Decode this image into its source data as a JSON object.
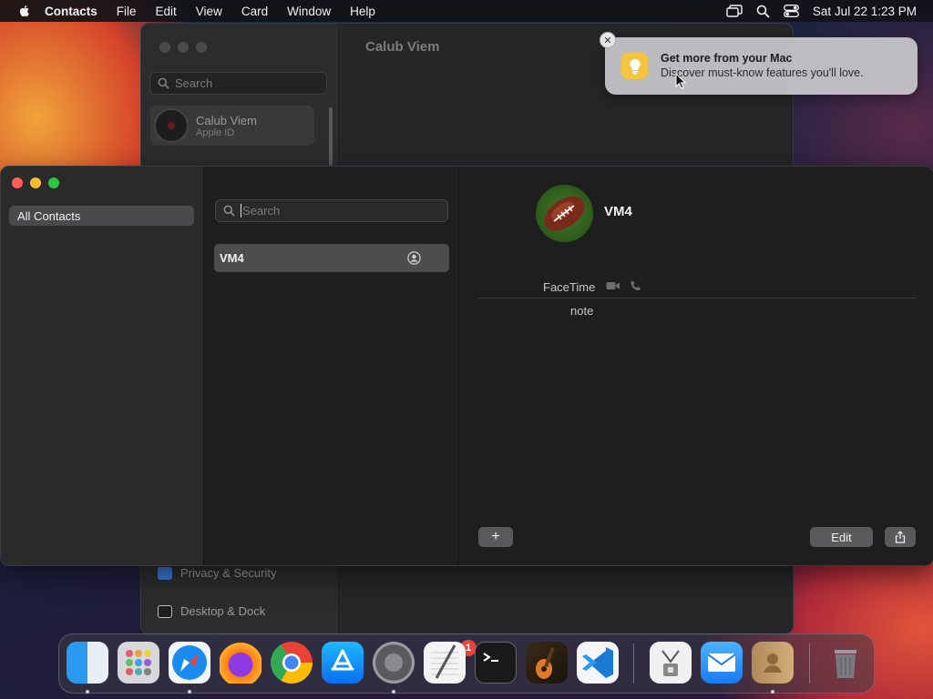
{
  "menubar": {
    "app_name": "Contacts",
    "items": [
      "File",
      "Edit",
      "View",
      "Card",
      "Window",
      "Help"
    ],
    "datetime": "Sat Jul 22  1:23 PM"
  },
  "background_window": {
    "title": "Calub Viem",
    "search_placeholder": "Search",
    "account_name": "Calub Viem",
    "account_subtitle": "Apple ID",
    "sidebar_items": [
      "Privacy & Security",
      "Desktop & Dock"
    ]
  },
  "notification": {
    "title": "Get more from your Mac",
    "body": "Discover must-know features you'll love.",
    "close_glyph": "✕"
  },
  "contacts": {
    "groups": [
      "All Contacts"
    ],
    "search_placeholder": "Search",
    "list": [
      "VM4"
    ],
    "selected": {
      "name": "VM4",
      "facetime_label": "FaceTime",
      "note_label": "note"
    },
    "add_label": "+",
    "edit_label": "Edit"
  },
  "dock": {
    "apps": [
      "Finder",
      "Launchpad",
      "Safari",
      "Firefox",
      "Chrome",
      "App Store",
      "System Settings",
      "TextEdit",
      "Terminal",
      "GarageBand",
      "VS Code",
      "Archive Utility",
      "Mail",
      "Contacts",
      "Trash"
    ],
    "settings_badge": "1"
  },
  "colors": {
    "close": "#ff5f57",
    "minimize": "#febc2e",
    "zoom": "#28c840",
    "badge": "#e8453c"
  }
}
